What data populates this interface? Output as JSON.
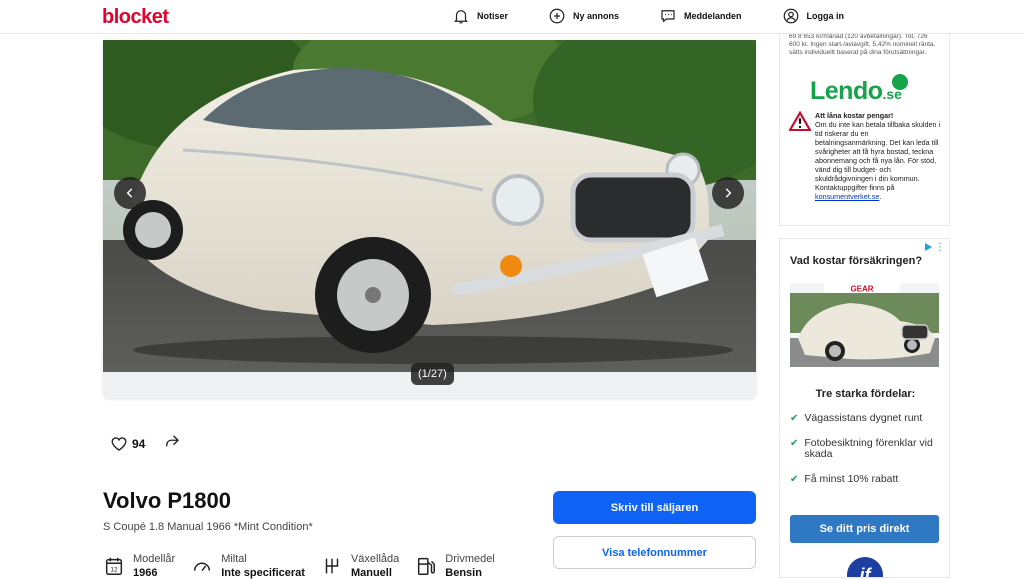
{
  "header": {
    "logo": "blocket",
    "nav": [
      {
        "label": "Notiser",
        "icon": "bell-icon"
      },
      {
        "label": "Ny annons",
        "icon": "plus-circle-icon"
      },
      {
        "label": "Meddelanden",
        "icon": "chat-icon"
      },
      {
        "label": "Logga in",
        "icon": "user-icon"
      }
    ]
  },
  "gallery": {
    "counter": "(1/27)",
    "prev_icon": "chevron-left-icon",
    "next_icon": "chevron-right-icon"
  },
  "actions": {
    "favorites_count": "94",
    "favorite_icon": "heart-icon",
    "share_icon": "share-icon"
  },
  "listing": {
    "title": "Volvo P1800",
    "subtitle": "S Coupé 1.8 Manual 1966 *Mint Condition*",
    "facts": [
      {
        "label": "Modellår",
        "value": "1966",
        "icon": "calendar-icon"
      },
      {
        "label": "Miltal",
        "value": "Inte specificerat",
        "icon": "speedometer-icon"
      },
      {
        "label": "Växellåda",
        "value": "Manuell",
        "icon": "gearbox-icon"
      },
      {
        "label": "Drivmedel",
        "value": "Bensin",
        "icon": "fuel-pump-icon"
      }
    ]
  },
  "buttons": {
    "contact_seller": "Skriv till säljaren",
    "show_phone": "Visa telefonnummer"
  },
  "ad_lendo": {
    "small_print": "69 8 653 kr/månad (120 avbetalningar). Tot. 726 600 kr. Ingen start-/aviavgift. 5,42% nominell ränta, sätts individuellt baserat på dina förutsättningar.",
    "brand_name": "Lendo",
    "brand_tld": ".se",
    "warning_title": "Att låna kostar pengar!",
    "warning_text": "Om du inte kan betala tillbaka skulden i tid riskerar du en betalningsanmärkning. Det kan leda till svårigheter att få hyra bostad, teckna abonnemang och få nya lån. För stöd, vänd dig till budget- och skuldrådgivningen i din kommun. Kontaktuppgifter finns på",
    "warning_link": "konsumentverket.se",
    "warning_end": "."
  },
  "ad_insurance": {
    "heading": "Vad kostar försäkringen?",
    "plate_text": "GEAR",
    "subheading": "Tre starka fördelar:",
    "benefits": [
      "Vägassistans dygnet runt",
      "Fotobesiktning förenklar vid skada",
      "Få minst 10% rabatt"
    ],
    "cta": "Se ditt pris direkt",
    "brand": "if"
  },
  "colors": {
    "brand_red": "#e4002b",
    "primary_blue": "#0e63f4",
    "lendo_green": "#16a34a",
    "if_blue": "#1c3fa1"
  }
}
